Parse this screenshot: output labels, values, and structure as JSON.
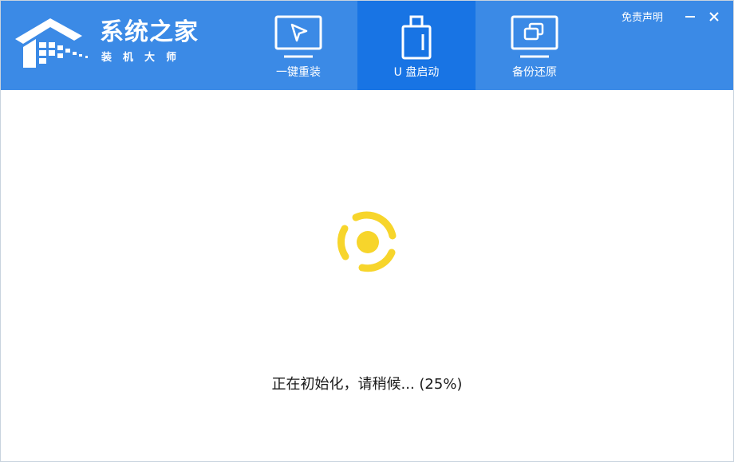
{
  "app": {
    "brand_title": "系统之家",
    "brand_subtitle": "装机大师",
    "logo_icon": "house-logo-icon"
  },
  "nav": {
    "tabs": [
      {
        "label": "一键重装",
        "icon": "monitor-cursor-icon",
        "active": false
      },
      {
        "label": "U 盘启动",
        "icon": "usb-drive-icon",
        "active": true
      },
      {
        "label": "备份还原",
        "icon": "monitor-copy-icon",
        "active": false
      }
    ]
  },
  "window_controls": {
    "disclaimer": "免责声明",
    "minimize_icon": "minimize-icon",
    "close_icon": "close-icon"
  },
  "main": {
    "spinner_icon": "loading-spinner-icon",
    "status_text": "正在初始化，请稍候... (25%)",
    "progress_percent": 25
  },
  "colors": {
    "header_bg": "#3b8ae6",
    "active_tab_bg": "#1874e4",
    "spinner": "#f7d52b"
  }
}
